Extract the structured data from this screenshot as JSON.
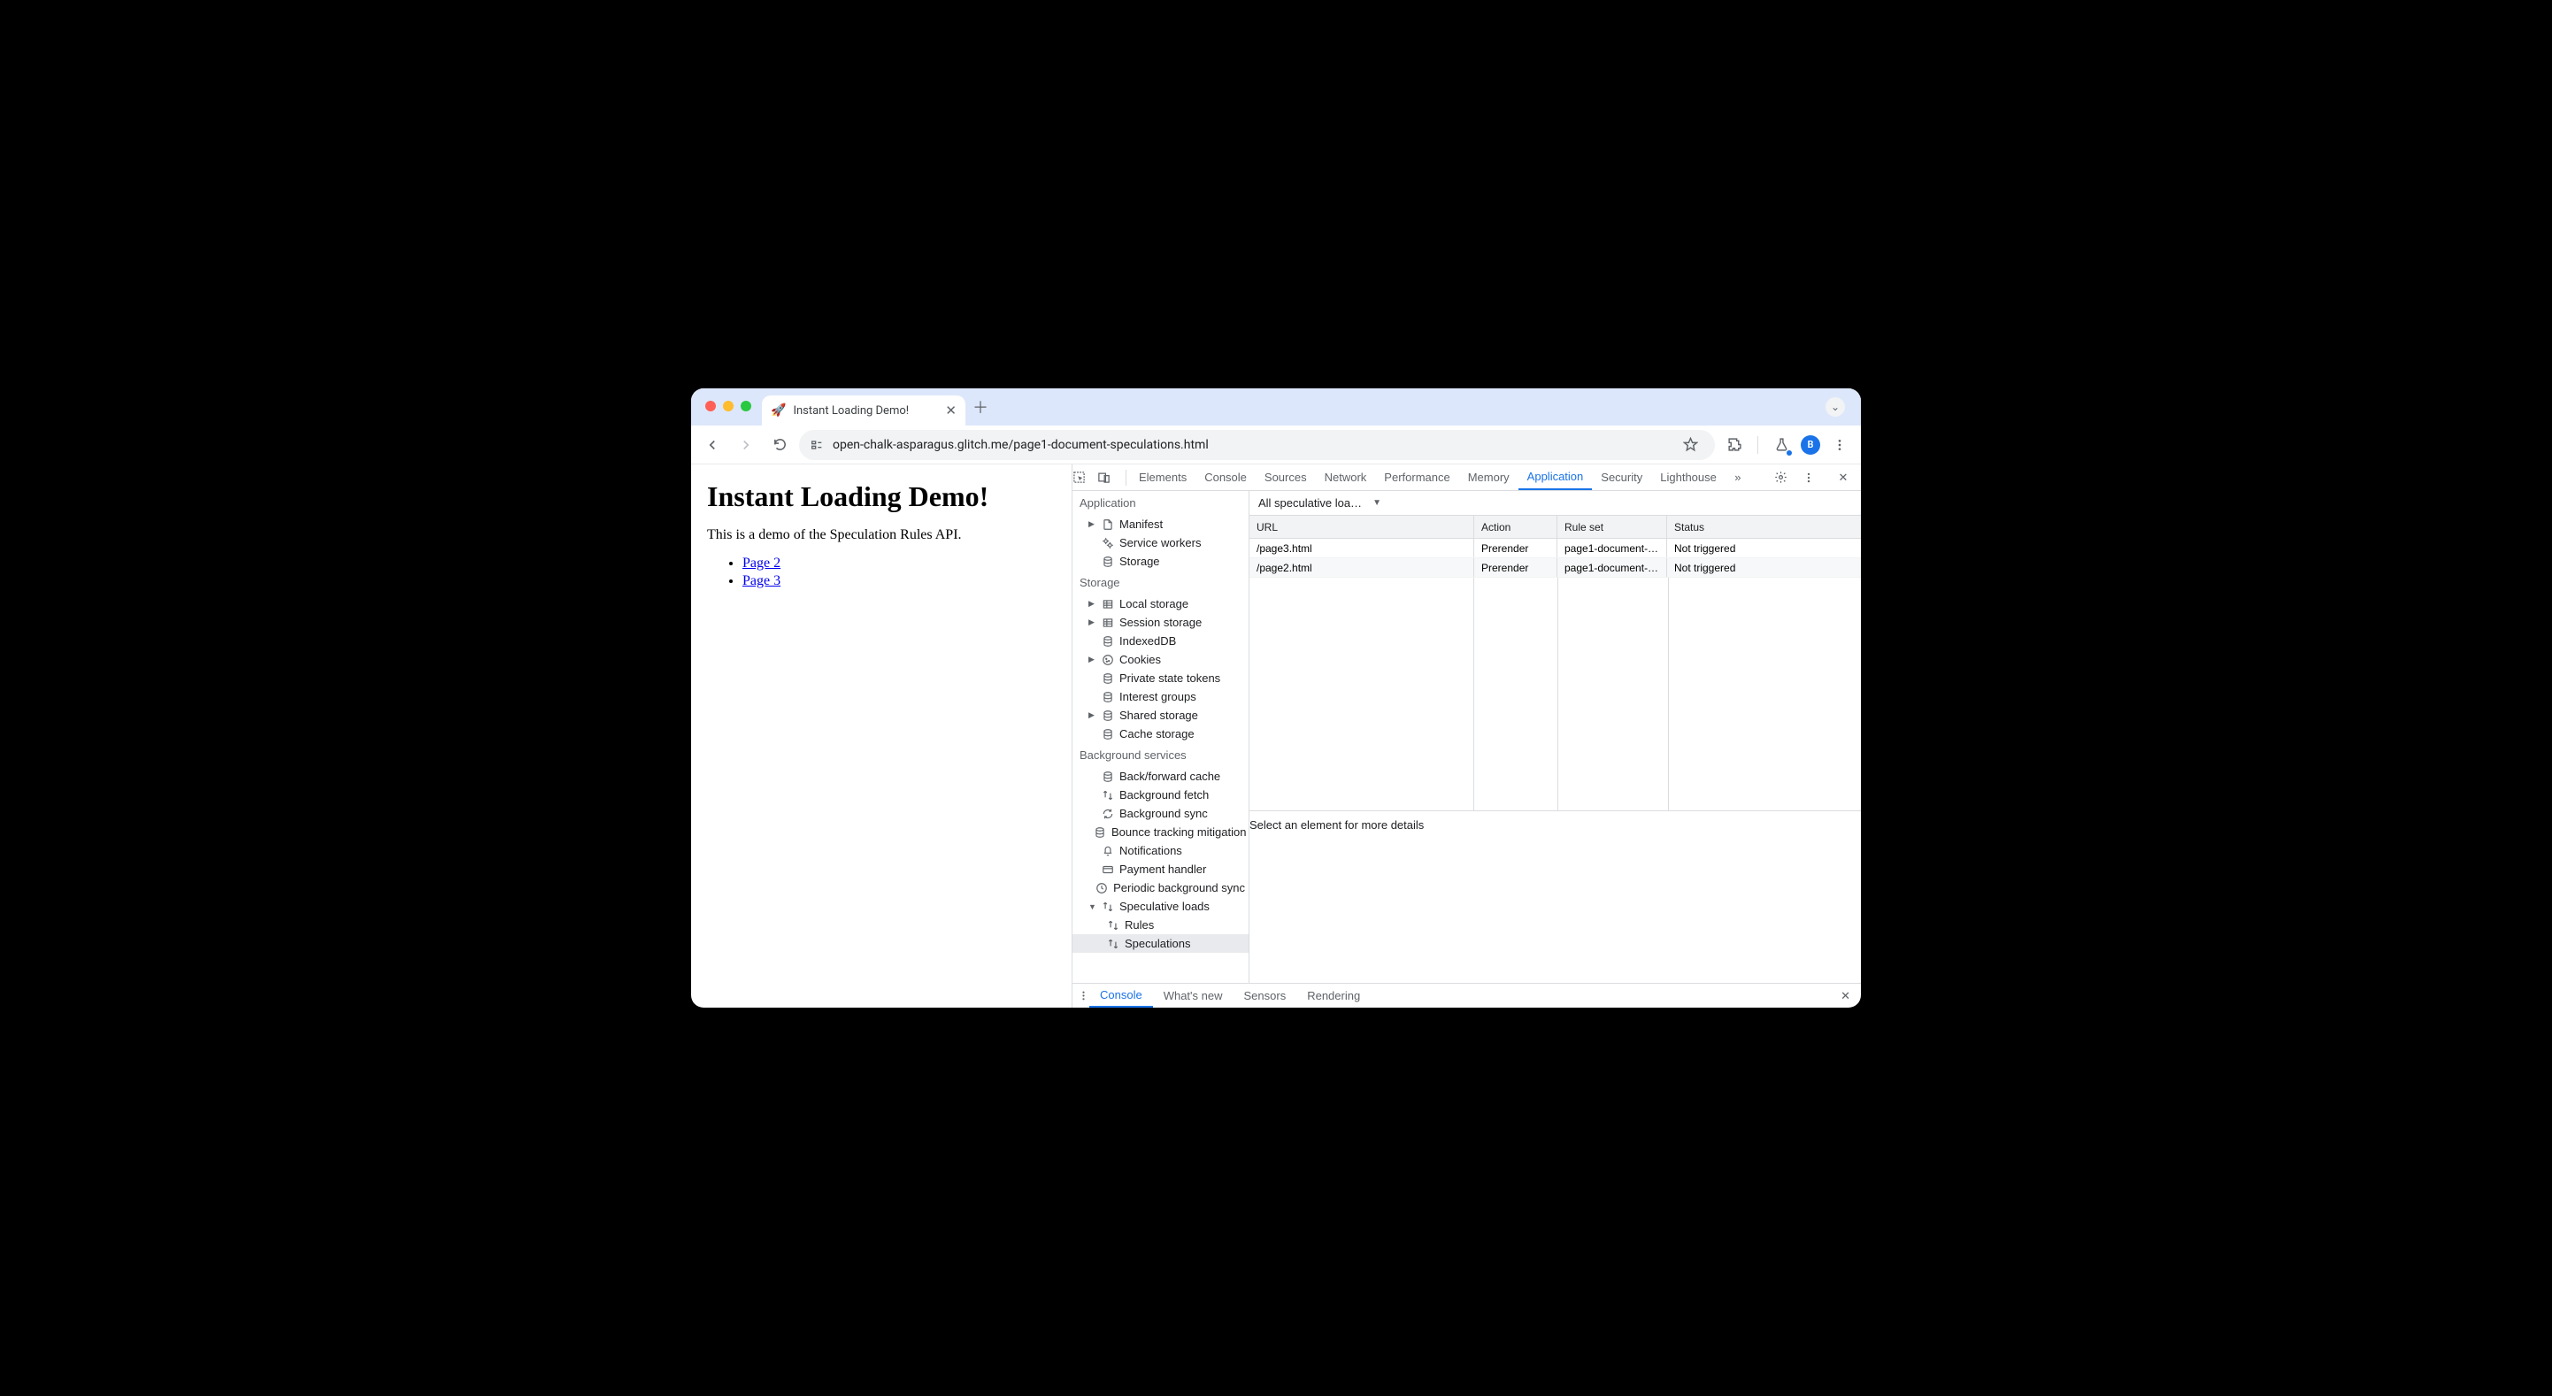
{
  "window": {
    "tab_title": "Instant Loading Demo!",
    "url": "open-chalk-asparagus.glitch.me/page1-document-speculations.html",
    "avatar_letter": "B"
  },
  "page": {
    "heading": "Instant Loading Demo!",
    "subtext": "This is a demo of the Speculation Rules API.",
    "links": [
      "Page 2",
      "Page 3"
    ]
  },
  "devtools": {
    "tabs": [
      "Elements",
      "Console",
      "Sources",
      "Network",
      "Performance",
      "Memory",
      "Application",
      "Security",
      "Lighthouse"
    ],
    "active_tab": "Application",
    "sidebar": {
      "groups": [
        {
          "title": "Application",
          "items": [
            {
              "label": "Manifest",
              "icon": "file",
              "expandable": true
            },
            {
              "label": "Service workers",
              "icon": "gears"
            },
            {
              "label": "Storage",
              "icon": "db"
            }
          ]
        },
        {
          "title": "Storage",
          "items": [
            {
              "label": "Local storage",
              "icon": "table",
              "expandable": true
            },
            {
              "label": "Session storage",
              "icon": "table",
              "expandable": true
            },
            {
              "label": "IndexedDB",
              "icon": "db"
            },
            {
              "label": "Cookies",
              "icon": "cookie",
              "expandable": true
            },
            {
              "label": "Private state tokens",
              "icon": "db"
            },
            {
              "label": "Interest groups",
              "icon": "db"
            },
            {
              "label": "Shared storage",
              "icon": "db",
              "expandable": true
            },
            {
              "label": "Cache storage",
              "icon": "db"
            }
          ]
        },
        {
          "title": "Background services",
          "items": [
            {
              "label": "Back/forward cache",
              "icon": "db"
            },
            {
              "label": "Background fetch",
              "icon": "swap"
            },
            {
              "label": "Background sync",
              "icon": "sync"
            },
            {
              "label": "Bounce tracking mitigation",
              "icon": "db"
            },
            {
              "label": "Notifications",
              "icon": "bell"
            },
            {
              "label": "Payment handler",
              "icon": "card"
            },
            {
              "label": "Periodic background sync",
              "icon": "clock"
            },
            {
              "label": "Speculative loads",
              "icon": "swap",
              "expandable": true,
              "expanded": true,
              "children": [
                {
                  "label": "Rules",
                  "icon": "swap"
                },
                {
                  "label": "Speculations",
                  "icon": "swap",
                  "selected": true
                }
              ]
            }
          ]
        }
      ]
    },
    "filter_label": "All speculative loa…",
    "table": {
      "headers": [
        "URL",
        "Action",
        "Rule set",
        "Status"
      ],
      "rows": [
        {
          "url": "/page3.html",
          "action": "Prerender",
          "ruleset": "page1-document-…",
          "status": "Not triggered"
        },
        {
          "url": "/page2.html",
          "action": "Prerender",
          "ruleset": "page1-document-…",
          "status": "Not triggered"
        }
      ]
    },
    "detail_placeholder": "Select an element for more details",
    "drawer_tabs": [
      "Console",
      "What's new",
      "Sensors",
      "Rendering"
    ],
    "drawer_active": "Console"
  }
}
